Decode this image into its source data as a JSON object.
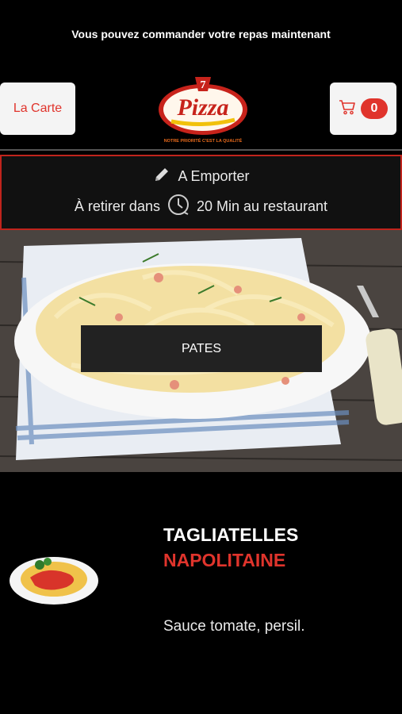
{
  "banner": {
    "message": "Vous pouvez commander votre repas maintenant"
  },
  "header": {
    "menu_button_label": "La Carte",
    "logo": {
      "number": "7",
      "brand": "Pizza",
      "tagline": "NOTRE PRIORITÉ C'EST LA QUALITÉ"
    },
    "cart_count": "0"
  },
  "order": {
    "mode_label": "A Emporter",
    "pickup_prefix": "À retirer dans",
    "pickup_suffix": "20 Min au restaurant"
  },
  "category": {
    "label": "PATES"
  },
  "product": {
    "name_line1": "TAGLIATELLES",
    "name_line2": "NAPOLITAINE",
    "description": "Sauce tomate, persil."
  },
  "colors": {
    "accent": "#e0342c",
    "background": "#000000",
    "button_bg": "#f4f4f4"
  }
}
